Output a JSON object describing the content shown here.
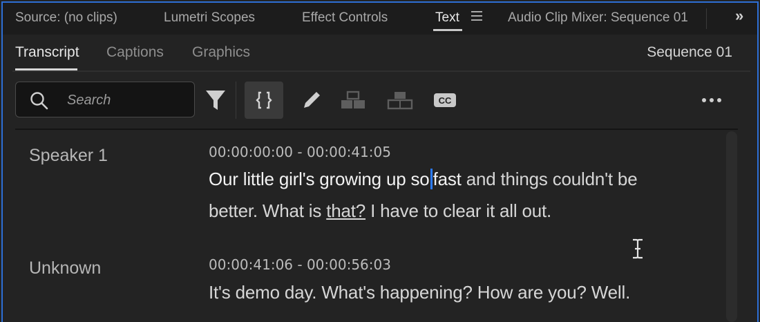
{
  "panel_tabs": [
    {
      "label": "Source: (no clips)"
    },
    {
      "label": "Lumetri Scopes"
    },
    {
      "label": "Effect Controls"
    },
    {
      "label": "Text"
    },
    {
      "label": "Audio Clip Mixer: Sequence 01"
    }
  ],
  "overflow_symbol": "»",
  "sub_tabs": [
    {
      "label": "Transcript"
    },
    {
      "label": "Captions"
    },
    {
      "label": "Graphics"
    }
  ],
  "sequence_name": "Sequence 01",
  "search": {
    "placeholder": "Search",
    "value": ""
  },
  "toolbar": {
    "icons": [
      "filter-icon",
      "merge-segments-icon",
      "edit-pencil-icon",
      "split-speakers-icon",
      "merge-speakers-icon",
      "captions-cc-icon",
      "more-options-icon"
    ],
    "cc_label": "CC"
  },
  "transcript": [
    {
      "speaker": "Speaker 1",
      "timecode": "00:00:00:00 - 00:00:41:05",
      "line1_a": "Our little girl's growing up so",
      "line1_b": "fast",
      "line1_c": " and things couldn't be",
      "line2_a": "better. What is ",
      "line2_b": "that?",
      "line2_c": " I have to clear it all out."
    },
    {
      "speaker": "Unknown",
      "timecode": "00:00:41:06 - 00:00:56:03",
      "line1": "It's demo day. What's happening? How are you? Well."
    }
  ],
  "colors": {
    "accent": "#2d6fd6",
    "cursor": "#2b7bff",
    "background": "#232323"
  }
}
